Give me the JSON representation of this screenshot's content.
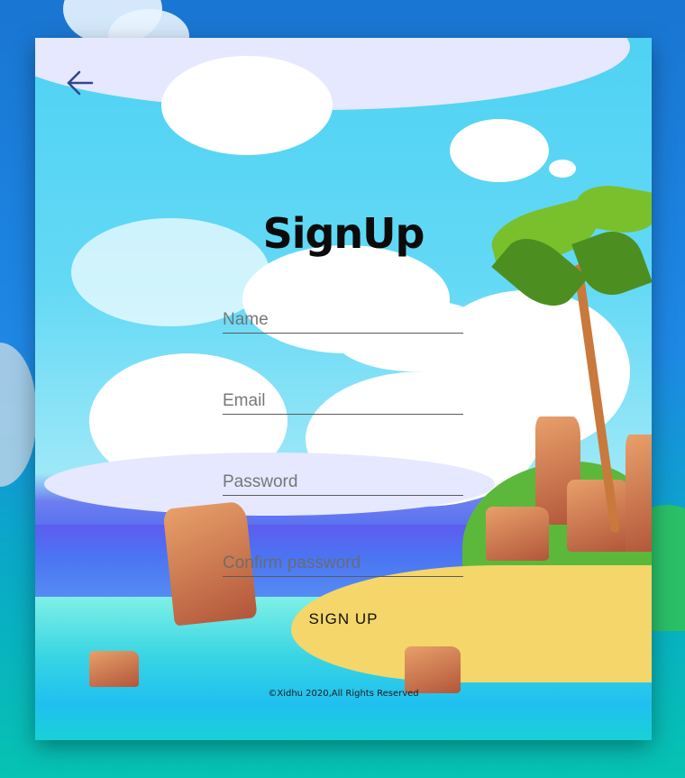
{
  "header": {
    "back_icon": "arrow-left-icon"
  },
  "form": {
    "title": "SignUp",
    "name_placeholder": "Name",
    "email_placeholder": "Email",
    "password_placeholder": "Password",
    "confirm_placeholder": "Confirm password",
    "submit_label": "SIGN UP"
  },
  "footer": {
    "copyright": "©Xidhu 2020,All Rights Reserved"
  },
  "colors": {
    "title": "#0b0b0b",
    "underline": "#5b5b5b",
    "icon": "#2e4a8c"
  }
}
